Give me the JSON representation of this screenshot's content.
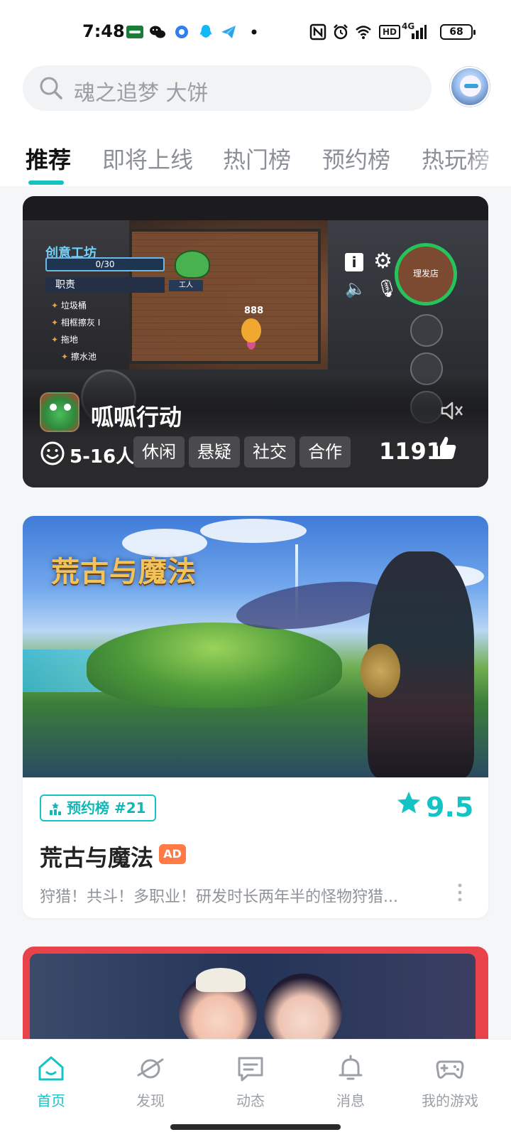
{
  "status_bar": {
    "time": "7:48",
    "battery": "68",
    "network": "4G",
    "hd_label": "HD"
  },
  "search": {
    "placeholder": "魂之追梦 大饼"
  },
  "tabs": [
    {
      "label": "推荐",
      "active": true
    },
    {
      "label": "即将上线",
      "active": false
    },
    {
      "label": "热门榜",
      "active": false
    },
    {
      "label": "预约榜",
      "active": false
    },
    {
      "label": "热玩榜",
      "active": false
    }
  ],
  "featured_game": {
    "title": "呱呱行动",
    "players": "5-16人",
    "tags": [
      "休闲",
      "悬疑",
      "社交",
      "合作"
    ],
    "likes": "1191",
    "screenshot_text": {
      "workshop": "创意工坊",
      "progress": "0/30",
      "role": "职责",
      "tasks": [
        "垃圾桶",
        "相框擦灰 I",
        "拖地",
        "擦水池"
      ],
      "npc_label": "工人",
      "score": "888",
      "shop": "理发店"
    }
  },
  "ad_game": {
    "banner_logo": "荒古与魔法",
    "rank_badge": "预约榜 #21",
    "rating": "9.5",
    "title": "荒古与魔法",
    "ad_label": "AD",
    "description": "狩猎！共斗！多职业！研发时长两年半的怪物狩猎..."
  },
  "bottom_nav": [
    {
      "label": "首页",
      "icon": "home-icon",
      "active": true
    },
    {
      "label": "发现",
      "icon": "planet-icon",
      "active": false
    },
    {
      "label": "动态",
      "icon": "message-icon",
      "active": false
    },
    {
      "label": "消息",
      "icon": "bell-icon",
      "active": false
    },
    {
      "label": "我的游戏",
      "icon": "gamepad-icon",
      "active": false
    }
  ],
  "colors": {
    "accent": "#14c4c4",
    "ad": "#ff7a45",
    "card_dark": "#1c1c1e"
  }
}
